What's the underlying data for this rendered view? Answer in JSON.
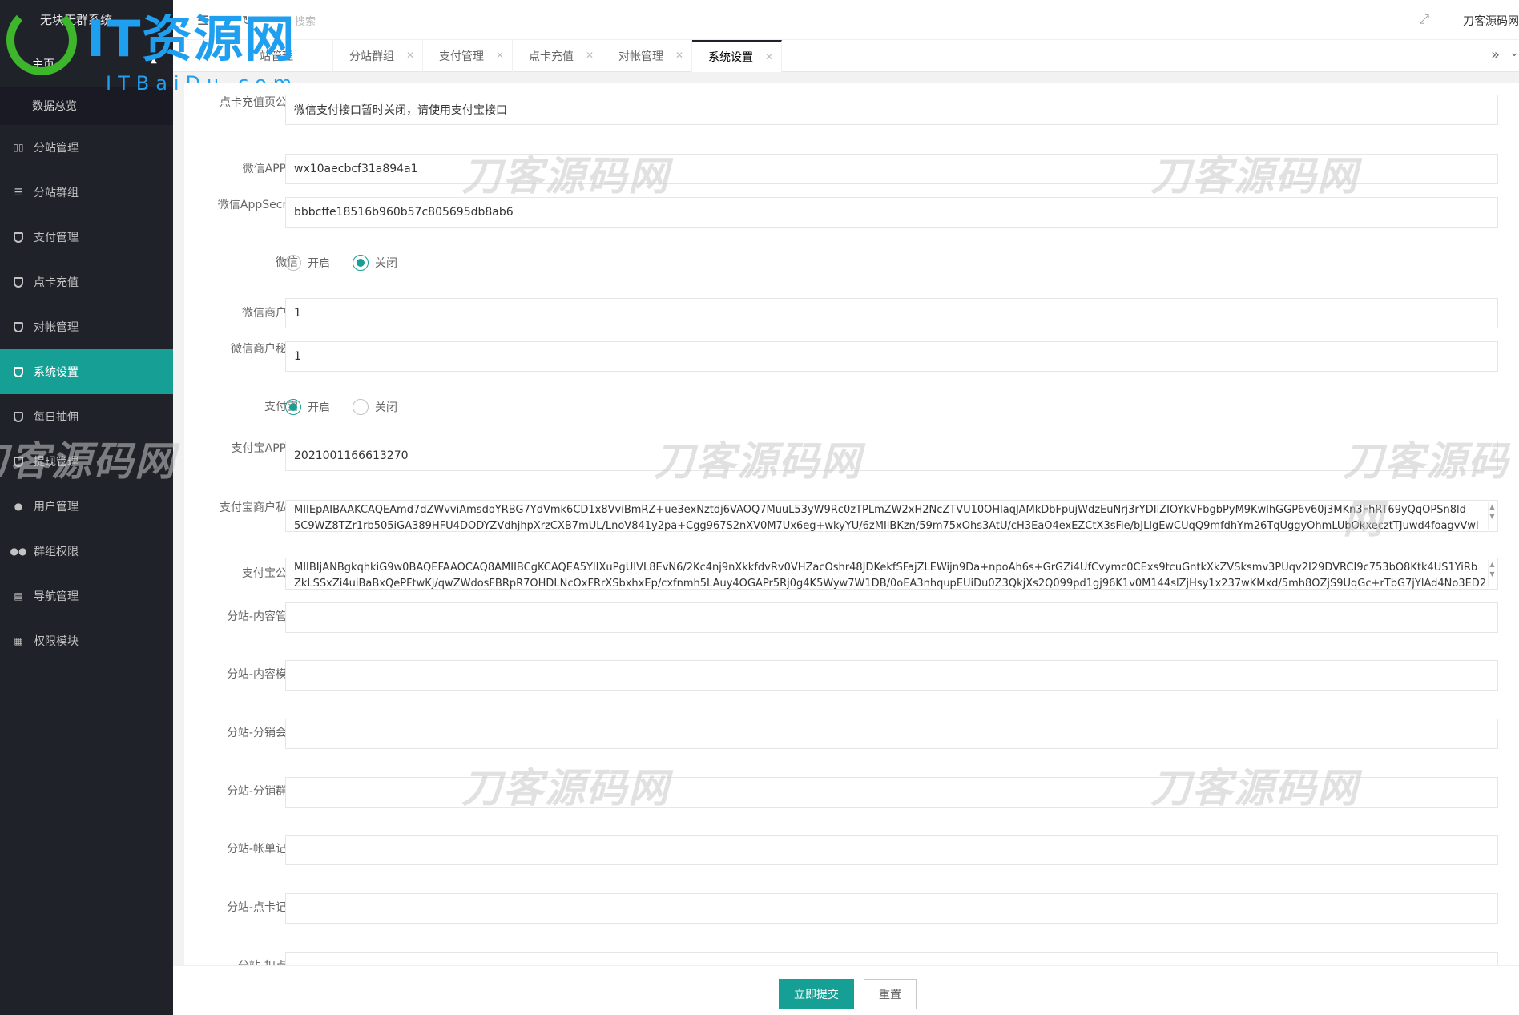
{
  "brand": {
    "system_title": "无块无群系统",
    "logo_text": "IT资源网",
    "logo_sub": "ITBaiDu.com"
  },
  "header": {
    "search_placeholder": "搜索",
    "site_name": "刀客源码网"
  },
  "sidebar": {
    "home_label": "主页",
    "sub_item": "数据总览",
    "items": [
      {
        "label": "分站管理",
        "icon": "columns-icon"
      },
      {
        "label": "分站群组",
        "icon": "sliders-icon"
      },
      {
        "label": "支付管理",
        "icon": "shield-icon"
      },
      {
        "label": "点卡充值",
        "icon": "shield-icon"
      },
      {
        "label": "对帐管理",
        "icon": "shield-icon"
      },
      {
        "label": "系统设置",
        "icon": "shield-icon",
        "active": true
      },
      {
        "label": "每日抽佣",
        "icon": "shield-icon"
      },
      {
        "label": "提现管理",
        "icon": "shield-icon"
      },
      {
        "label": "用户管理",
        "icon": "user-icon"
      },
      {
        "label": "群组权限",
        "icon": "users-icon"
      },
      {
        "label": "导航管理",
        "icon": "nav-icon"
      },
      {
        "label": "权限模块",
        "icon": "grid-icon"
      }
    ]
  },
  "tabs": [
    {
      "label": "站管理"
    },
    {
      "label": "分站群组"
    },
    {
      "label": "支付管理"
    },
    {
      "label": "点卡充值"
    },
    {
      "label": "对帐管理"
    },
    {
      "label": "系统设置",
      "active": true
    }
  ],
  "form": {
    "card_notice_label": "点卡充值页公告",
    "card_notice_value": "微信支付接口暂时关闭，请使用支付宝接口",
    "wx_appid_label": "微信APPID",
    "wx_appid_value": "wx10aecbcf31a894a1",
    "wx_secret_label": "微信AppSecret",
    "wx_secret_value": "bbbcffe18516b960b57c805695db8ab6",
    "wx_label": "微信",
    "open_label": "开启",
    "close_label": "关闭",
    "wx_mch_label": "微信商户号",
    "wx_mch_value": "1",
    "wx_mch_key_label": "微信商户秘钥",
    "wx_mch_key_value": "1",
    "alipay_label": "支付宝",
    "alipay_appid_label": "支付宝APPID",
    "alipay_appid_value": "2021001166613270",
    "alipay_private_label": "支付宝商户私钥",
    "alipay_private_line1": "MIIEpAIBAAKCAQEAmd7dZWvviAmsdoYRBG7YdVmk6CD1x8VviBmRZ+ue3exNztdj6VAOQ7MuuL53yW9Rc0zTPLmZW2xH2NcZTVU10OHlaqJAMkDbFpujWdzEuNrj3rYDIlZIOYkVFbgbPyM9KwlhGGP6v60j3MKn3FhRT69yQqOPSn8ld",
    "alipay_private_line2": "5C9WZ8TZr1rb505iGA389HFU4DODYZVdhjhpXrzCXB7mUL/LnoV841y2pa+Cgg967S2nXV0M7Ux6eg+wkyYU/6zMIlBKzn/59m75xOhs3AtU/cH3EaO4exEZCtX3sFie/bJLlgEwCUqQ9mfdhYm26TqUggyOhmLUbOkxecztTJuwd4foagvVwl",
    "alipay_public_label": "支付宝公钥",
    "alipay_public_line1": "MIIBIjANBgkqhkiG9w0BAQEFAAOCAQ8AMIIBCgKCAQEA5YlIXuPgUIVL8EvN6/2Kc4nj9nXkkfdvRv0VHZacOshr48JDKekfSFajZLEWijn9Da+npoAh6s+GrGZi4UfCvymc0CExs9tcuGntkXkZVSksmv3PUqv2I29DVRCI9c753bO8Ktk4US1YiRb",
    "alipay_public_line2": "ZkLSSxZi4uiBaBxQePFtwKj/qwZWdosFBRpR7OHDLNcOxFRrXSbxhxEp/cxfnmh5LAuy4OGAPr5Rj0g4K5Wyw7W1DB/0oEA3nhqupEUiDu0Z3QkjXs2Q099pd1gj96K1v0M144slZjHsy1x237wKMxd/5mh8OZjS9UqGc+rTbG7jYlAd4No3ED2",
    "fz_content_label": "分站-内容管理",
    "fz_template_label": "分站-内容模板",
    "fz_member_label": "分站-分销会员",
    "fz_group_label": "分站-分销群组",
    "fz_bill_label": "分站-帐单记录",
    "fz_card_label": "分站-点卡记录",
    "fz_points_label": "分站-扣点记"
  },
  "watermark": "刀客源码网",
  "actions": {
    "submit_label": "立即提交",
    "reset_label": "重置"
  },
  "colors": {
    "sidebar_bg": "#20222a",
    "accent": "#16a095"
  }
}
